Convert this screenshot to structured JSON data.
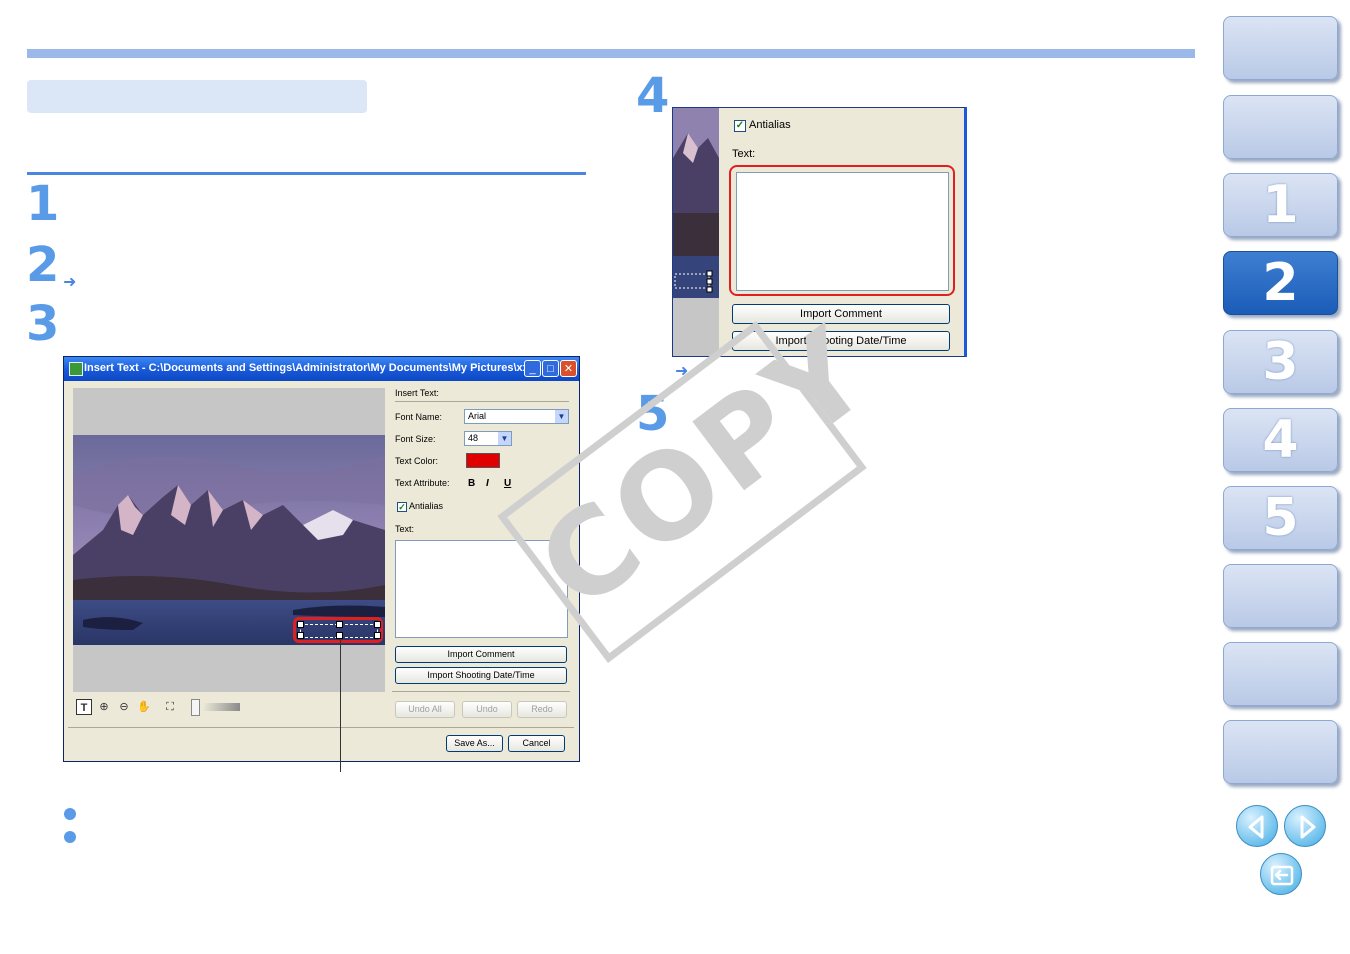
{
  "page": {
    "steps": [
      "1",
      "2",
      "3",
      "4",
      "5"
    ],
    "arrow_glyph": "➜"
  },
  "dialog": {
    "title": "Insert Text - C:\\Documents and Settings\\Administrator\\My Documents\\My Pictures\\xxxx_x...",
    "minimize_glyph": "_",
    "maximize_glyph": "□",
    "close_glyph": "✕",
    "insert_text_label": "Insert Text:",
    "font_name_label": "Font Name:",
    "font_name_value": "Arial",
    "font_size_label": "Font Size:",
    "font_size_value": "48",
    "text_color_label": "Text Color:",
    "text_color": "#e00000",
    "text_attribute_label": "Text Attribute:",
    "attr_bold": "B",
    "attr_italic": "I",
    "attr_underline": "U",
    "antialias_label": "Antialias",
    "antialias_checked": true,
    "text_label": "Text:",
    "import_comment": "Import Comment",
    "import_shooting": "Import Shooting Date/Time",
    "undo_all": "Undo All",
    "undo": "Undo",
    "redo": "Redo",
    "save_as": "Save As...",
    "cancel": "Cancel",
    "tools": [
      "text-tool",
      "zoom-in",
      "zoom-out",
      "hand",
      "fit"
    ],
    "tool_glyphs": {
      "text": "T",
      "zoom_in": "⊕",
      "zoom_out": "⊖",
      "hand": "✋",
      "fit": "⛶"
    }
  },
  "zoom_panel": {
    "antialias_label": "Antialias",
    "text_label": "Text:",
    "import_comment": "Import Comment",
    "import_shooting": "Import Shooting Date/Time"
  },
  "watermark": "COPY",
  "nav_tabs": [
    {
      "label": "",
      "active": false
    },
    {
      "label": "",
      "active": false
    },
    {
      "label": "1",
      "active": false
    },
    {
      "label": "2",
      "active": true
    },
    {
      "label": "3",
      "active": false
    },
    {
      "label": "4",
      "active": false
    },
    {
      "label": "5",
      "active": false
    },
    {
      "label": "",
      "active": false
    },
    {
      "label": "",
      "active": false
    },
    {
      "label": "",
      "active": false
    }
  ],
  "colors": {
    "accent": "#5a9be8",
    "highlight": "#e02020",
    "active_tab": "#2a6cc7"
  }
}
